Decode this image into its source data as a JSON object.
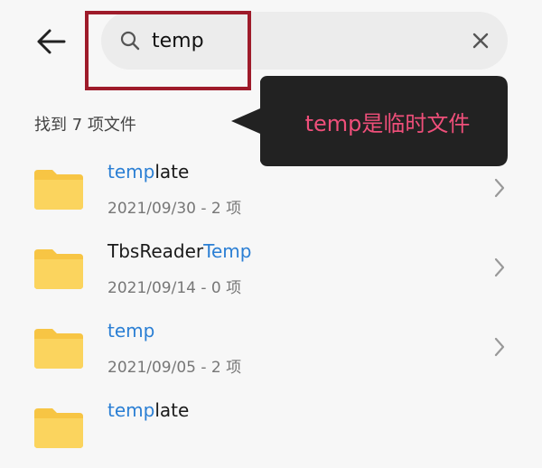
{
  "search": {
    "query": "temp"
  },
  "annotation": {
    "text": "temp是临时文件"
  },
  "results": {
    "count_label": "找到 7 项文件",
    "items": [
      {
        "prefix": "",
        "match": "temp",
        "suffix": "late",
        "meta": "2021/09/30 - 2 项"
      },
      {
        "prefix": "TbsReader",
        "match": "Temp",
        "suffix": "",
        "meta": "2021/09/14 - 0 项"
      },
      {
        "prefix": "",
        "match": "temp",
        "suffix": "",
        "meta": "2021/09/05 - 2 项"
      },
      {
        "prefix": "",
        "match": "temp",
        "suffix": "late",
        "meta": ""
      }
    ]
  },
  "colors": {
    "match_highlight": "#2b7fd4",
    "folder": "#f7c544",
    "annotation_box": "#222222",
    "annotation_text": "#ef4f7a",
    "highlight_frame": "#9e1b2a"
  },
  "icons": {
    "back": "back-arrow-icon",
    "search": "search-icon",
    "clear": "close-icon",
    "folder": "folder-icon",
    "chevron": "chevron-right-icon"
  }
}
